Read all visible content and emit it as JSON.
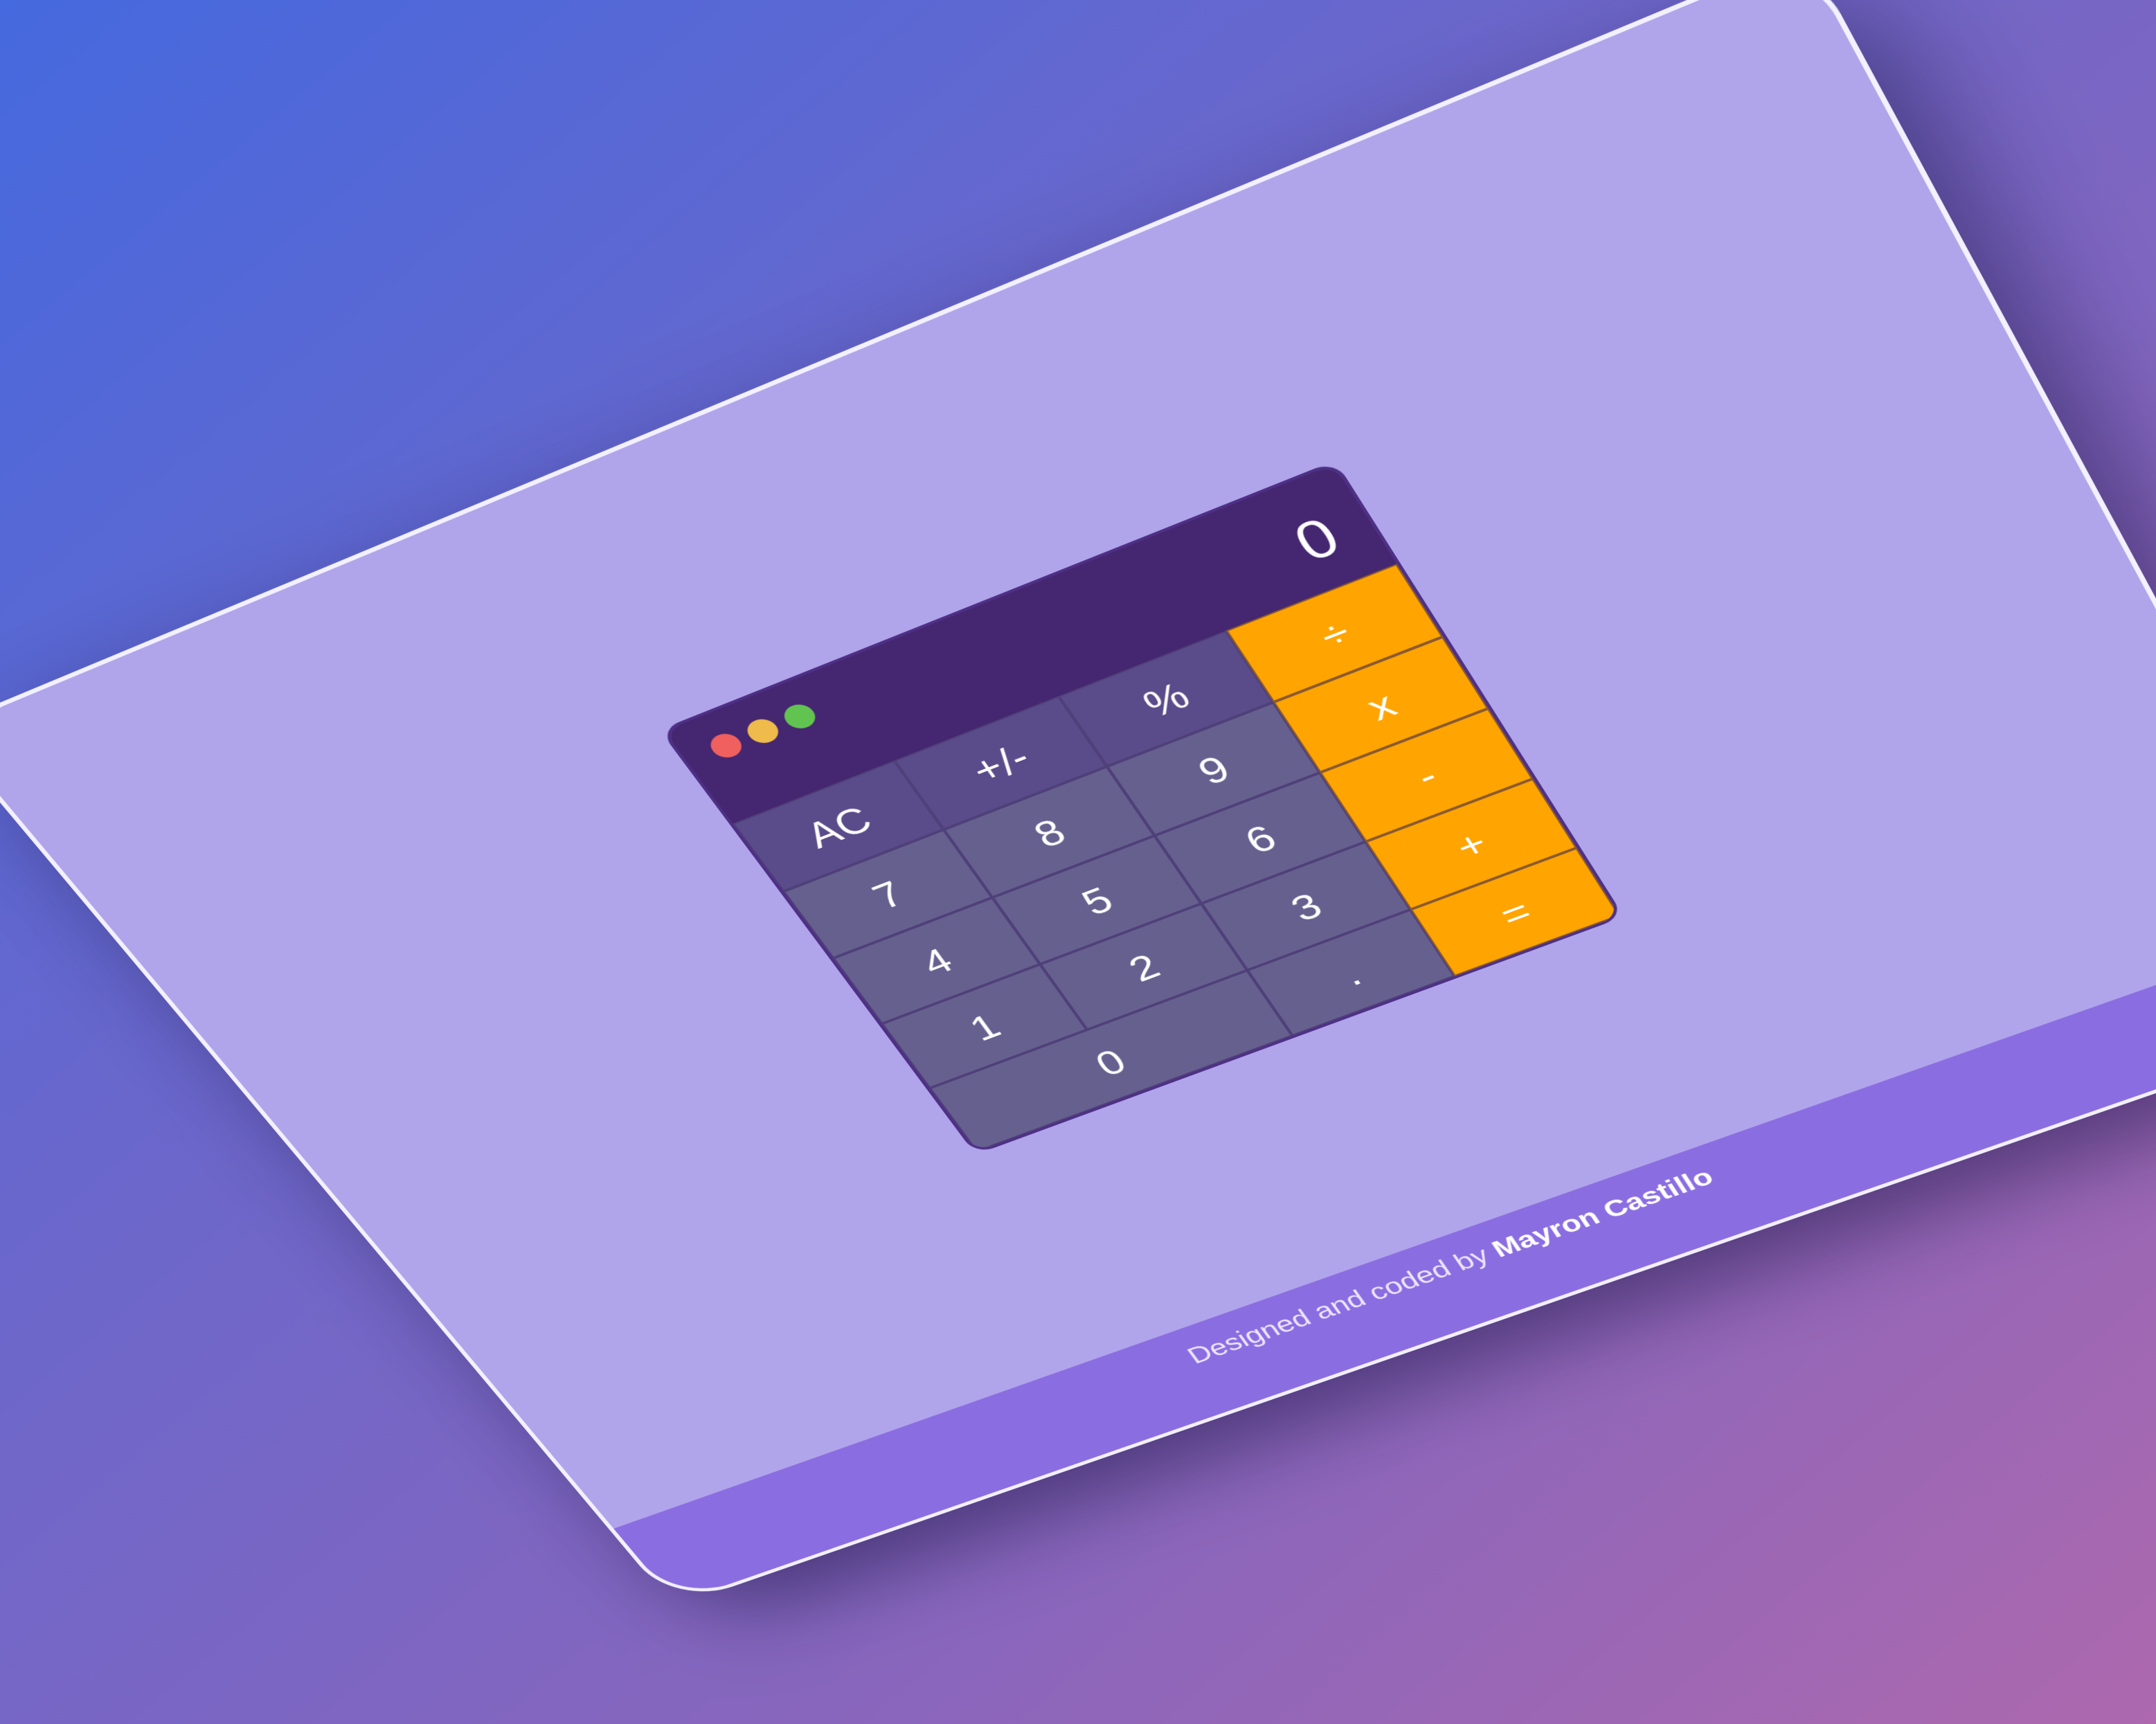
{
  "calculator": {
    "display": "0",
    "window_controls": {
      "close_color": "#f0605f",
      "minimize_color": "#efbb4a",
      "maximize_color": "#62c450"
    },
    "keys": {
      "ac": "AC",
      "plus_minus": "+/-",
      "percent": "%",
      "divide": "÷",
      "seven": "7",
      "eight": "8",
      "nine": "9",
      "multiply": "x",
      "four": "4",
      "five": "5",
      "six": "6",
      "minus": "-",
      "one": "1",
      "two": "2",
      "three": "3",
      "plus": "+",
      "zero": "0",
      "decimal": ".",
      "equals": "="
    }
  },
  "footer": {
    "prefix": "Designed and coded by ",
    "author": "Mayron Castillo"
  },
  "colors": {
    "page_background": "#b0a5ea",
    "footer_bar": "#8b6de2",
    "calculator_header": "#452670",
    "digit_key": "#66608f",
    "function_key": "#5a4b8a",
    "operator_key": "#ffa400"
  }
}
